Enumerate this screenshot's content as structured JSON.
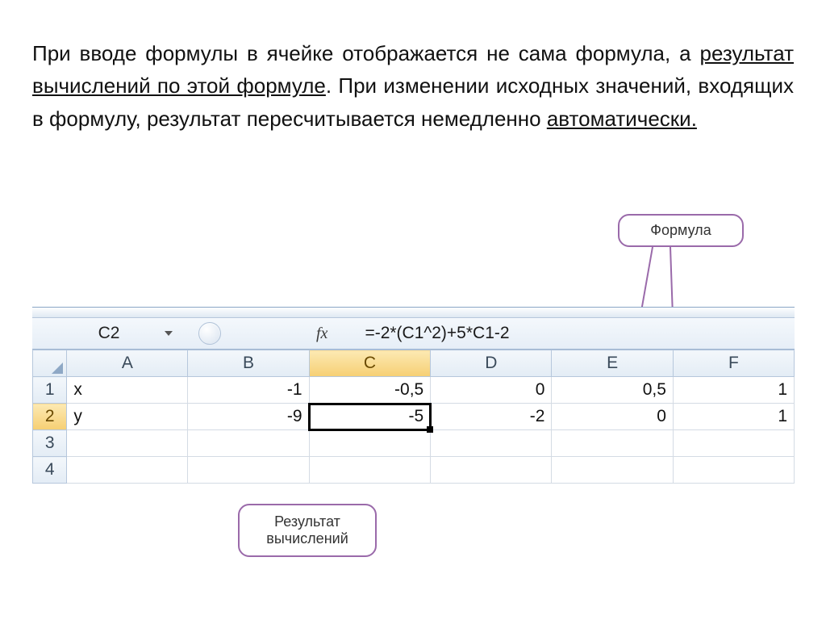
{
  "paragraph": {
    "p1a": "При вводе формулы в ячейке отображается не сама формула, а ",
    "p1b": "результат вычислений по этой формуле",
    "p1c": ". При изменении исходных значений, входящих в формулу, результат пересчитывается немедленно ",
    "p1d": "автоматически."
  },
  "callouts": {
    "formula": "Формула",
    "result": "Результат вычислений"
  },
  "spreadsheet": {
    "name_box": "C2",
    "fx": "fx",
    "formula": "=-2*(C1^2)+5*C1-2",
    "columns": [
      "A",
      "B",
      "C",
      "D",
      "E",
      "F"
    ],
    "row_heads": [
      "1",
      "2",
      "3",
      "4"
    ],
    "cells": {
      "r1": {
        "A": "x",
        "B": "-1",
        "C": "-0,5",
        "D": "0",
        "E": "0,5",
        "F": "1"
      },
      "r2": {
        "A": "y",
        "B": "-9",
        "C": "-5",
        "D": "-2",
        "E": "0",
        "F": "1"
      },
      "r3": {
        "A": "",
        "B": "",
        "C": "",
        "D": "",
        "E": "",
        "F": ""
      },
      "r4": {
        "A": "",
        "B": "",
        "C": "",
        "D": "",
        "E": "",
        "F": ""
      }
    }
  },
  "chart_data": {
    "type": "table",
    "title": "Spreadsheet with formula result highlighted",
    "columns": [
      "A",
      "B",
      "C",
      "D",
      "E",
      "F"
    ],
    "rows": [
      {
        "label": "x",
        "values": [
          "-1",
          "-0,5",
          "0",
          "0,5",
          "1"
        ]
      },
      {
        "label": "y",
        "values": [
          "-9",
          "-5",
          "-2",
          "0",
          "1"
        ]
      }
    ],
    "selected_cell": "C2",
    "formula": "=-2*(C1^2)+5*C1-2"
  },
  "colors": {
    "callout_border": "#9a6aaa",
    "col_highlight": "#f6cf73"
  }
}
